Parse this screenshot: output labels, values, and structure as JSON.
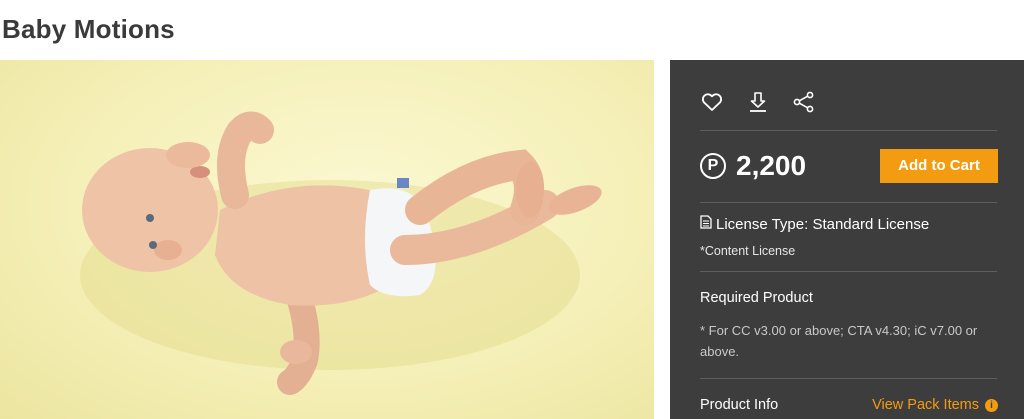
{
  "page": {
    "title": "Baby Motions"
  },
  "hero": {
    "alt": "Baby Motions product preview"
  },
  "actions": {
    "favorite_icon": "heart-icon",
    "download_icon": "download-icon",
    "share_icon": "share-icon"
  },
  "price": {
    "currency_symbol": "P",
    "amount": "2,200"
  },
  "cart": {
    "label": "Add to Cart"
  },
  "license": {
    "type_label": "License Type: Standard License",
    "content": "*Content License"
  },
  "required": {
    "title": "Required Product",
    "text": "* For CC v3.00 or above; CTA v4.30; iC v7.00 or above."
  },
  "product_info": {
    "label": "Product Info",
    "view_pack": "View Pack Items",
    "info_icon": "i"
  },
  "colors": {
    "panel_bg": "#3d3d3d",
    "accent": "#f39c12",
    "hero_bg": "#f5f0b8"
  }
}
